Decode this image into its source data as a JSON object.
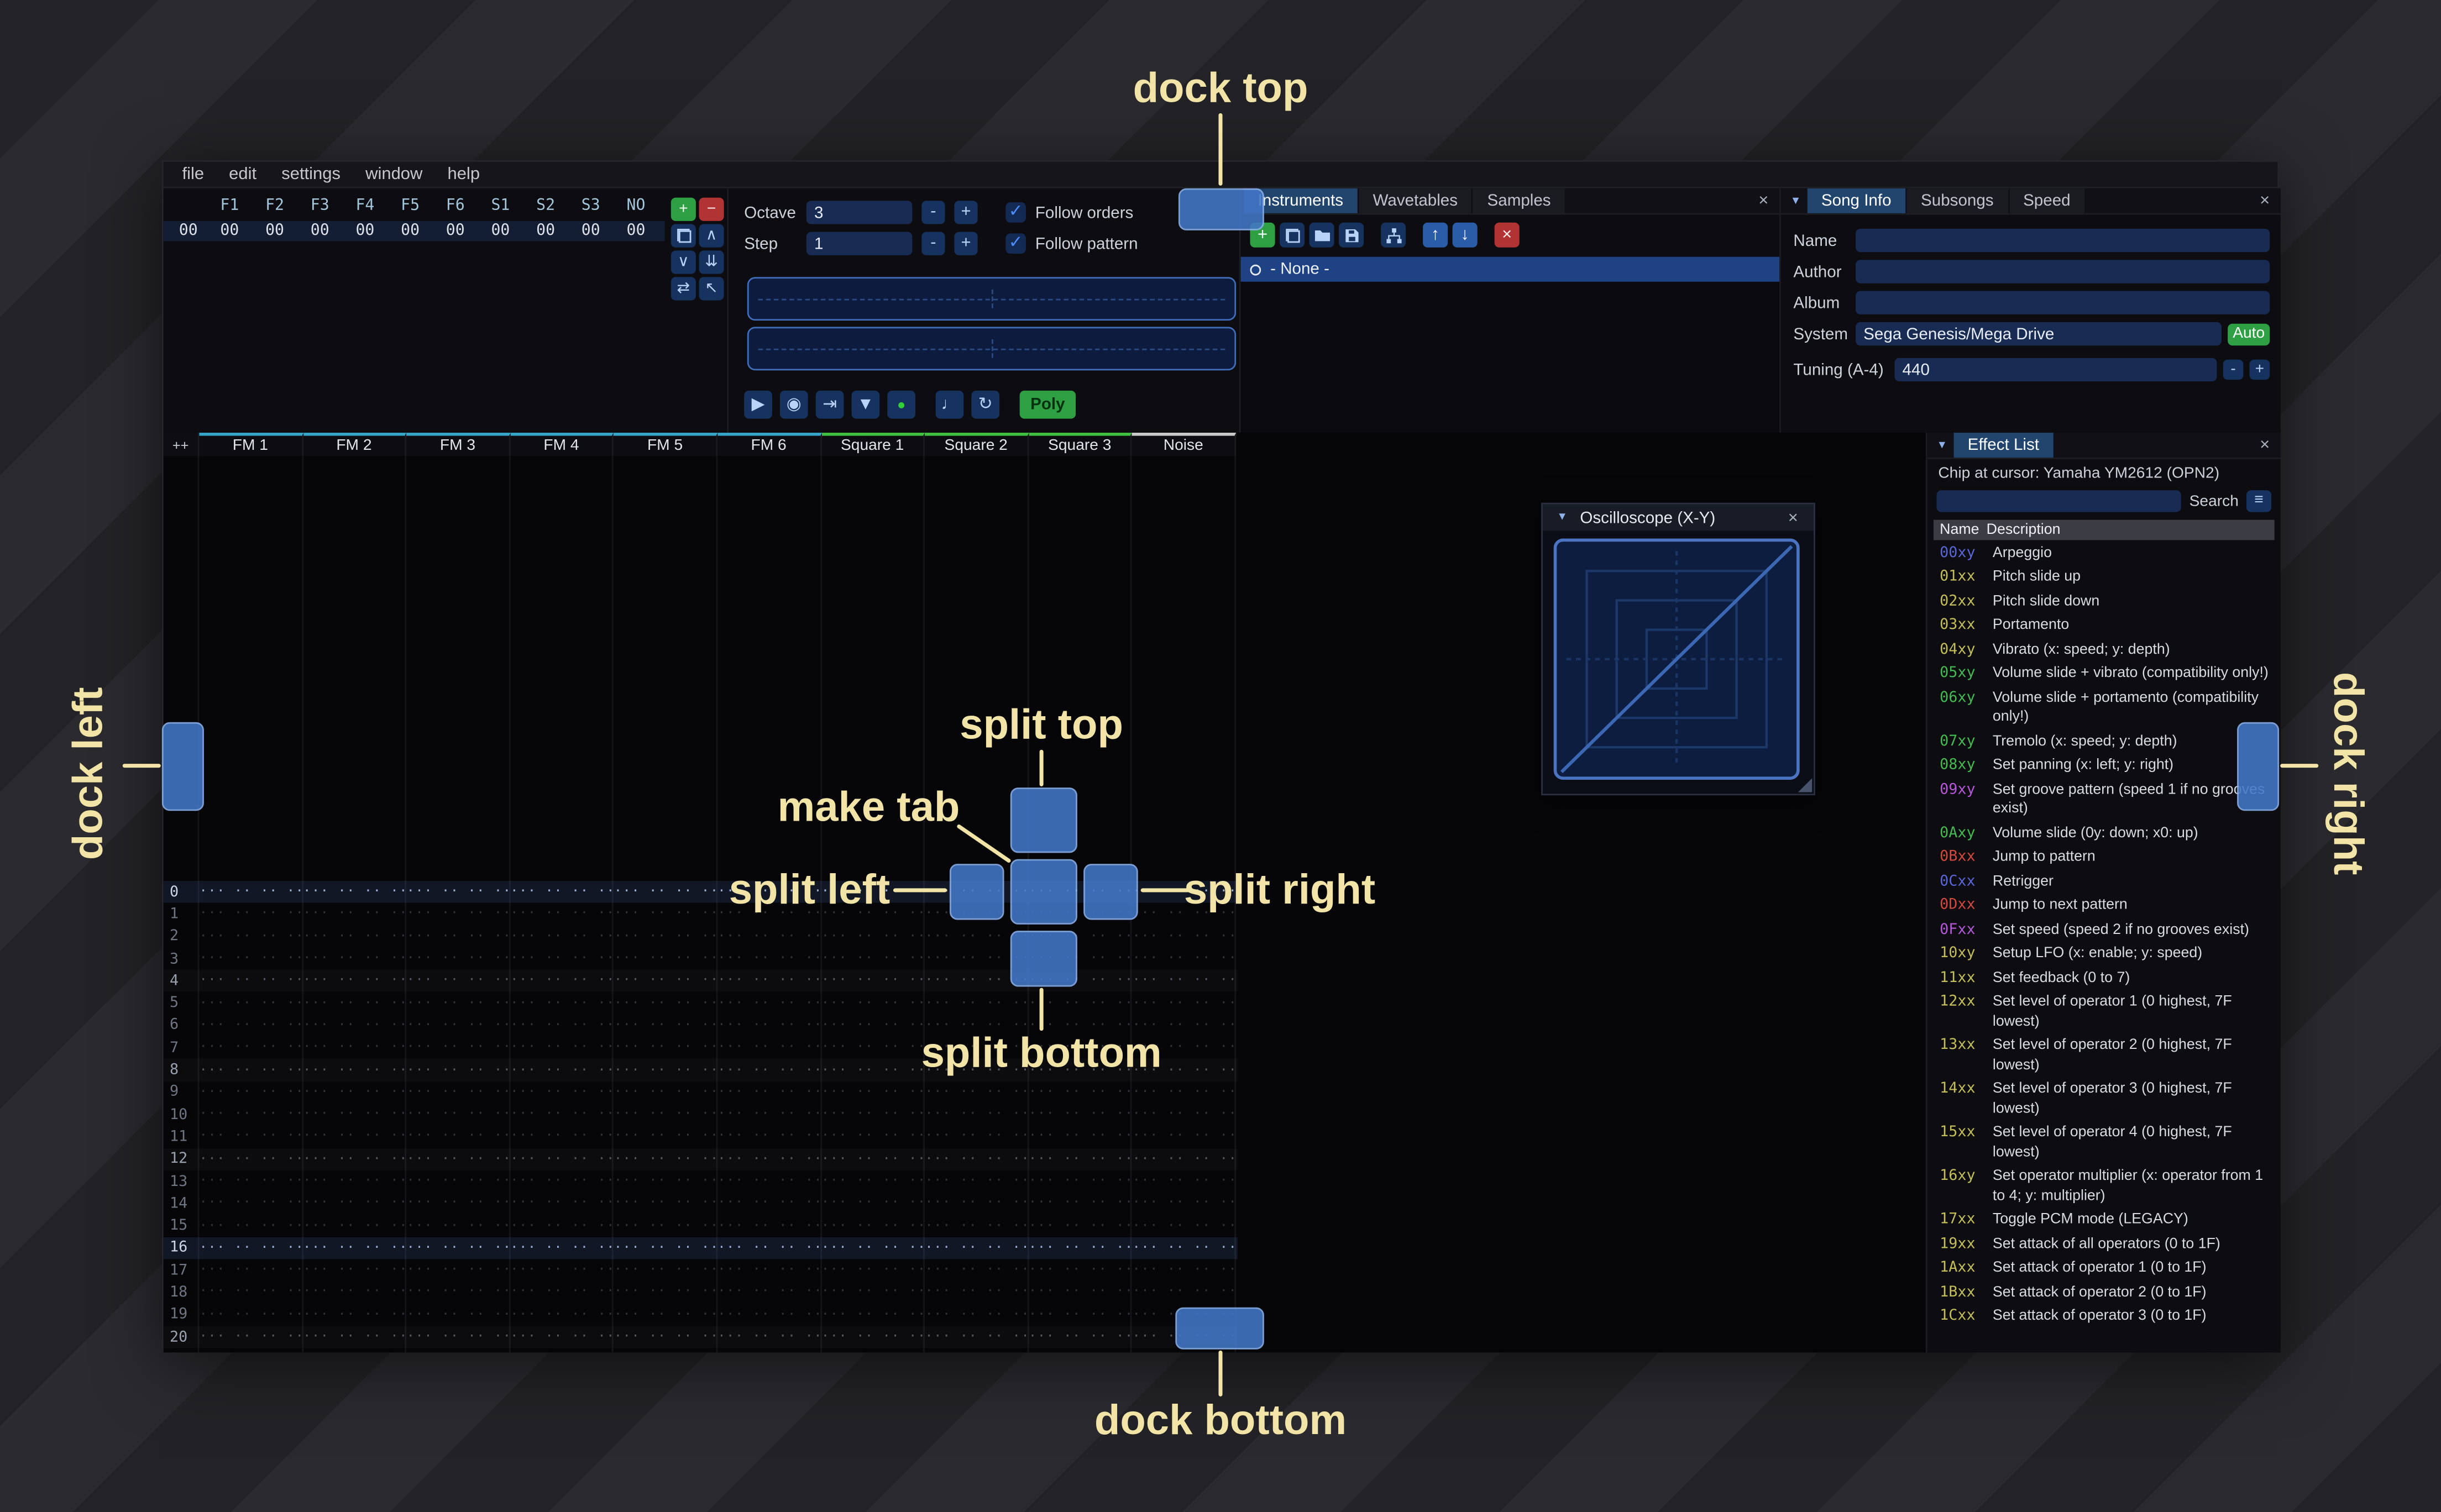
{
  "colors": {
    "annotation": "#f2e4a6",
    "dock": "#4377c8",
    "dockb": "#8ab2ee",
    "green": "#2ea043",
    "red": "#b23333",
    "record": "#35d035",
    "input": "#182b52",
    "tabactive": "#22456e",
    "check": "#4c8dff",
    "btnblue": "#16325e",
    "btnglyph": "#b9d2f8"
  },
  "icons": {
    "close": "×",
    "collapse": "▼",
    "burger": "≡",
    "check": "✓",
    "minus": "-",
    "plus": "+"
  },
  "overlay": {
    "labels": {
      "dock_top": "dock top",
      "dock_left": "dock left",
      "dock_right": "dock right",
      "dock_bottom": "dock bottom",
      "split_top": "split top",
      "split_left": "split left",
      "split_right": "split right",
      "split_bottom": "split bottom",
      "make_tab": "make tab"
    }
  },
  "menu": {
    "items": [
      "file",
      "edit",
      "settings",
      "window",
      "help"
    ]
  },
  "orders": {
    "row_label": "00",
    "channel_headers": [
      "F1",
      "F2",
      "F3",
      "F4",
      "F5",
      "F6",
      "S1",
      "S2",
      "S3",
      "NO"
    ],
    "row_values": [
      "00",
      "00",
      "00",
      "00",
      "00",
      "00",
      "00",
      "00",
      "00",
      "00"
    ],
    "buttons": [
      {
        "name": "add-order",
        "style": "green",
        "glyph": "+"
      },
      {
        "name": "remove-order",
        "style": "red",
        "glyph": "−"
      },
      {
        "name": "duplicate-order",
        "icon": "clone"
      },
      {
        "name": "move-order-up",
        "glyph": "∧"
      },
      {
        "name": "move-order-down",
        "glyph": "∨"
      },
      {
        "name": "duplicate-to-end",
        "glyph": "⇊"
      },
      {
        "name": "change-all-orders",
        "glyph": "⇄"
      },
      {
        "name": "order-edit-mode",
        "glyph": "↖"
      }
    ]
  },
  "play_controls": {
    "octave_label": "Octave",
    "octave_value": "3",
    "step_label": "Step",
    "step_value": "1",
    "follow_orders_label": "Follow orders",
    "follow_pattern_label": "Follow pattern",
    "transport": [
      {
        "name": "play",
        "glyph": "▶"
      },
      {
        "name": "play-from-cursor",
        "glyph": "◉"
      },
      {
        "name": "play-one-row",
        "glyph": "⇥"
      },
      {
        "name": "step-one-row",
        "glyph": "▼"
      },
      {
        "name": "edit-record",
        "glyph": "●",
        "style": "record"
      },
      {
        "name": "metronome",
        "glyph": "♩",
        "gap": true
      },
      {
        "name": "repeat-pattern",
        "glyph": "↻"
      },
      {
        "name": "poly",
        "glyph": "Poly",
        "style": "poly",
        "gap": true
      }
    ]
  },
  "asset_panel": {
    "tabs": [
      "Instruments",
      "Wavetables",
      "Samples"
    ],
    "active_tab": "Instruments",
    "toolbar": [
      {
        "name": "add-instrument",
        "style": "green",
        "glyph": "+"
      },
      {
        "name": "duplicate-instrument",
        "icon": "clone"
      },
      {
        "name": "open-instrument",
        "icon": "folder"
      },
      {
        "name": "save-instrument",
        "icon": "floppy"
      },
      {
        "name": "organize-instruments",
        "icon": "sitemap",
        "gap": true
      },
      {
        "name": "move-instrument-up",
        "style": "bright",
        "glyph": "↑",
        "gap": true
      },
      {
        "name": "move-instrument-down",
        "style": "bright",
        "glyph": "↓"
      },
      {
        "name": "delete-instrument",
        "style": "red",
        "glyph": "×",
        "gap": true
      }
    ],
    "list": [
      {
        "label": "- None -",
        "selected": true
      }
    ]
  },
  "song_info": {
    "tabs": [
      "Song Info",
      "Subsongs",
      "Speed"
    ],
    "active_tab": "Song Info",
    "fields": [
      {
        "label": "Name",
        "value": ""
      },
      {
        "label": "Author",
        "value": ""
      },
      {
        "label": "Album",
        "value": ""
      }
    ],
    "system_label": "System",
    "system_value": "Sega Genesis/Mega Drive",
    "auto_button": "Auto",
    "tuning_label": "Tuning (A-4)",
    "tuning_value": "440"
  },
  "pattern": {
    "corner_label": "++",
    "row_count": 22,
    "empty_cell": "··· ·· ·· ··",
    "type_colors": {
      "fm": "#35a5c8",
      "square": "#3fc03f",
      "noise": "#c9c9c9"
    },
    "channels": [
      {
        "name": "FM 1",
        "type": "fm"
      },
      {
        "name": "FM 2",
        "type": "fm"
      },
      {
        "name": "FM 3",
        "type": "fm"
      },
      {
        "name": "FM 4",
        "type": "fm"
      },
      {
        "name": "FM 5",
        "type": "fm"
      },
      {
        "name": "FM 6",
        "type": "fm"
      },
      {
        "name": "Square 1",
        "type": "square"
      },
      {
        "name": "Square 2",
        "type": "square"
      },
      {
        "name": "Square 3",
        "type": "square"
      },
      {
        "name": "Noise",
        "type": "noise"
      }
    ]
  },
  "oscilloscope": {
    "title": "Oscilloscope (X-Y)"
  },
  "effect_list": {
    "title": "Effect List",
    "chip_line": "Chip at cursor: Yamaha YM2612 (OPN2)",
    "search_label": "Search",
    "search_value": "",
    "columns": [
      "Name",
      "Description"
    ],
    "effects": [
      {
        "code": "00xy",
        "desc": "Arpeggio",
        "color": "#5a66d8"
      },
      {
        "code": "01xx",
        "desc": "Pitch slide up",
        "color": "#c4bf5b"
      },
      {
        "code": "02xx",
        "desc": "Pitch slide down",
        "color": "#c4bf5b"
      },
      {
        "code": "03xx",
        "desc": "Portamento",
        "color": "#c4bf5b"
      },
      {
        "code": "04xy",
        "desc": "Vibrato (x: speed; y: depth)",
        "color": "#c4bf5b"
      },
      {
        "code": "05xy",
        "desc": "Volume slide + vibrato (compatibility only!)",
        "color": "#46ba52"
      },
      {
        "code": "06xy",
        "desc": "Volume slide + portamento (compatibility only!)",
        "color": "#46ba52"
      },
      {
        "code": "07xy",
        "desc": "Tremolo (x: speed; y: depth)",
        "color": "#46ba52"
      },
      {
        "code": "08xy",
        "desc": "Set panning (x: left; y: right)",
        "color": "#46ba52"
      },
      {
        "code": "09xy",
        "desc": "Set groove pattern (speed 1 if no grooves exist)",
        "color": "#b557d9"
      },
      {
        "code": "0Axy",
        "desc": "Volume slide (0y: down; x0: up)",
        "color": "#46ba52"
      },
      {
        "code": "0Bxx",
        "desc": "Jump to pattern",
        "color": "#d1493f"
      },
      {
        "code": "0Cxx",
        "desc": "Retrigger",
        "color": "#5a66d8"
      },
      {
        "code": "0Dxx",
        "desc": "Jump to next pattern",
        "color": "#d1493f"
      },
      {
        "code": "0Fxx",
        "desc": "Set speed (speed 2 if no grooves exist)",
        "color": "#b557d9"
      },
      {
        "code": "10xy",
        "desc": "Setup LFO (x: enable; y: speed)",
        "color": "#c4bf5b"
      },
      {
        "code": "11xx",
        "desc": "Set feedback (0 to 7)",
        "color": "#c4bf5b"
      },
      {
        "code": "12xx",
        "desc": "Set level of operator 1 (0 highest, 7F lowest)",
        "color": "#c4bf5b"
      },
      {
        "code": "13xx",
        "desc": "Set level of operator 2 (0 highest, 7F lowest)",
        "color": "#c4bf5b"
      },
      {
        "code": "14xx",
        "desc": "Set level of operator 3 (0 highest, 7F lowest)",
        "color": "#c4bf5b"
      },
      {
        "code": "15xx",
        "desc": "Set level of operator 4 (0 highest, 7F lowest)",
        "color": "#c4bf5b"
      },
      {
        "code": "16xy",
        "desc": "Set operator multiplier (x: operator from 1 to 4; y: multiplier)",
        "color": "#c4bf5b"
      },
      {
        "code": "17xx",
        "desc": "Toggle PCM mode (LEGACY)",
        "color": "#c4bf5b"
      },
      {
        "code": "19xx",
        "desc": "Set attack of all operators (0 to 1F)",
        "color": "#c4bf5b"
      },
      {
        "code": "1Axx",
        "desc": "Set attack of operator 1 (0 to 1F)",
        "color": "#c4bf5b"
      },
      {
        "code": "1Bxx",
        "desc": "Set attack of operator 2 (0 to 1F)",
        "color": "#c4bf5b"
      },
      {
        "code": "1Cxx",
        "desc": "Set attack of operator 3 (0 to 1F)",
        "color": "#c4bf5b"
      }
    ]
  }
}
